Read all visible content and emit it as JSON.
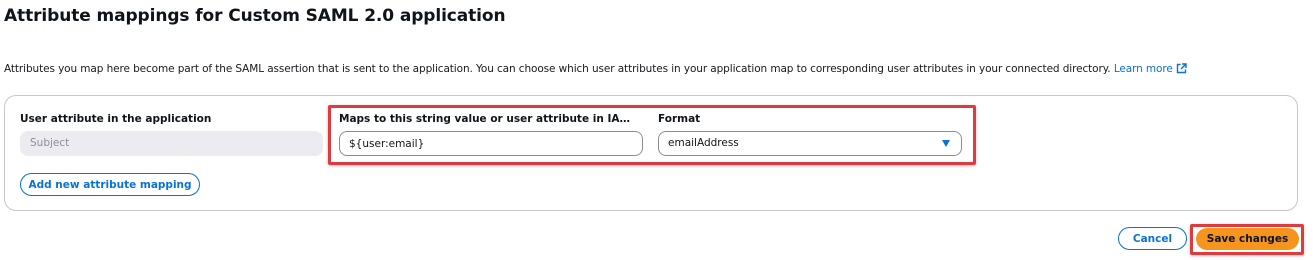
{
  "header": {
    "title": "Attribute mappings for Custom SAML 2.0 application"
  },
  "description": {
    "text": "Attributes you map here become part of the SAML assertion that is sent to the application. You can choose which user attributes in your application map to corresponding user attributes in your connected directory.",
    "learn_more_label": "Learn more",
    "learn_more_icon": "external-link-icon"
  },
  "mapping": {
    "user_attribute_label": "User attribute in the application",
    "user_attribute_value": "Subject",
    "maps_to_label": "Maps to this string value or user attribute in IAM Identi…",
    "maps_to_value": "${user:email}",
    "format_label": "Format",
    "format_value": "emailAddress"
  },
  "actions": {
    "add_mapping_label": "Add new attribute mapping",
    "cancel_label": "Cancel",
    "save_label": "Save changes"
  },
  "colors": {
    "accent": "#0972d3",
    "primary_button": "#f5951d",
    "highlight": "#e0393e"
  }
}
